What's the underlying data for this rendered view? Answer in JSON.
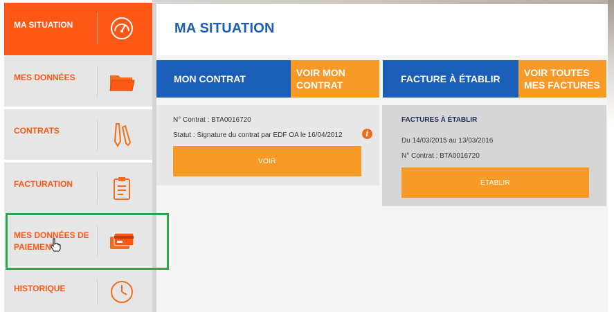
{
  "sidebar": {
    "items": [
      {
        "label": "MA SITUATION",
        "icon": "speedometer-icon",
        "active": true
      },
      {
        "label": "MES DONNÉES",
        "icon": "folder-icon",
        "active": false
      },
      {
        "label": "CONTRATS",
        "icon": "pen-icon",
        "active": false
      },
      {
        "label": "FACTURATION",
        "icon": "clipboard-icon",
        "active": false
      },
      {
        "label": "MES DONNÉES DE PAIEMENT",
        "icon": "credit-cards-icon",
        "active": false
      },
      {
        "label": "HISTORIQUE",
        "icon": "clock-icon",
        "active": false
      }
    ]
  },
  "main": {
    "title": "MA SITUATION",
    "contract_header": "MON CONTRAT",
    "contract_link": "VOIR MON CONTRAT",
    "invoice_header": "FACTURE À ÉTABLIR",
    "invoice_link": "VOIR TOUTES MES FACTURES",
    "contract_card": {
      "number": "N° Contrat : BTA0016720",
      "status": "Statut : Signature du contrat par EDF OA le 16/04/2012",
      "button": "VOIR"
    },
    "invoice_card": {
      "heading": "FACTURES À ÉTABLIR",
      "period": "Du 14/03/2015 au 13/03/2016",
      "number": "N° Contrat : BTA0016720",
      "button": "ÉTABLIR"
    }
  },
  "colors": {
    "accent_orange": "#fe5716",
    "button_orange": "#f89a28",
    "brand_blue": "#1a5eb8",
    "highlight_green": "#2aa84a"
  }
}
